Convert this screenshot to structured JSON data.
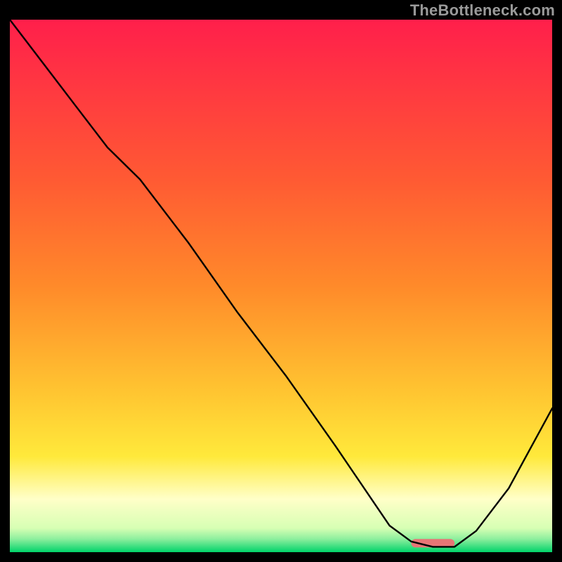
{
  "watermark": "TheBottleneck.com",
  "colors": {
    "gradient_top": "#ff1f4b",
    "gradient_mid1": "#ff8a2a",
    "gradient_mid2": "#ffe93b",
    "gradient_pale": "#ffffc8",
    "gradient_green": "#00d36a",
    "curve_stroke": "#000000",
    "marker_fill": "#e77676",
    "background": "#000000"
  },
  "chart_data": {
    "type": "line",
    "title": "",
    "xlabel": "",
    "ylabel": "",
    "xlim": [
      0,
      100
    ],
    "ylim": [
      0,
      100
    ],
    "grid": false,
    "legend": false,
    "series": [
      {
        "name": "bottleneck_curve",
        "x": [
          0,
          6,
          12,
          18,
          24,
          33,
          42,
          51,
          60,
          66,
          70,
          74,
          78,
          82,
          86,
          92,
          100
        ],
        "values": [
          100,
          92,
          84,
          76,
          70,
          58,
          45,
          33,
          20,
          11,
          5,
          2,
          1,
          1,
          4,
          12,
          27
        ]
      }
    ],
    "marker": {
      "x_start": 74,
      "x_end": 82,
      "y": 0.9,
      "color": "#e77676"
    }
  }
}
